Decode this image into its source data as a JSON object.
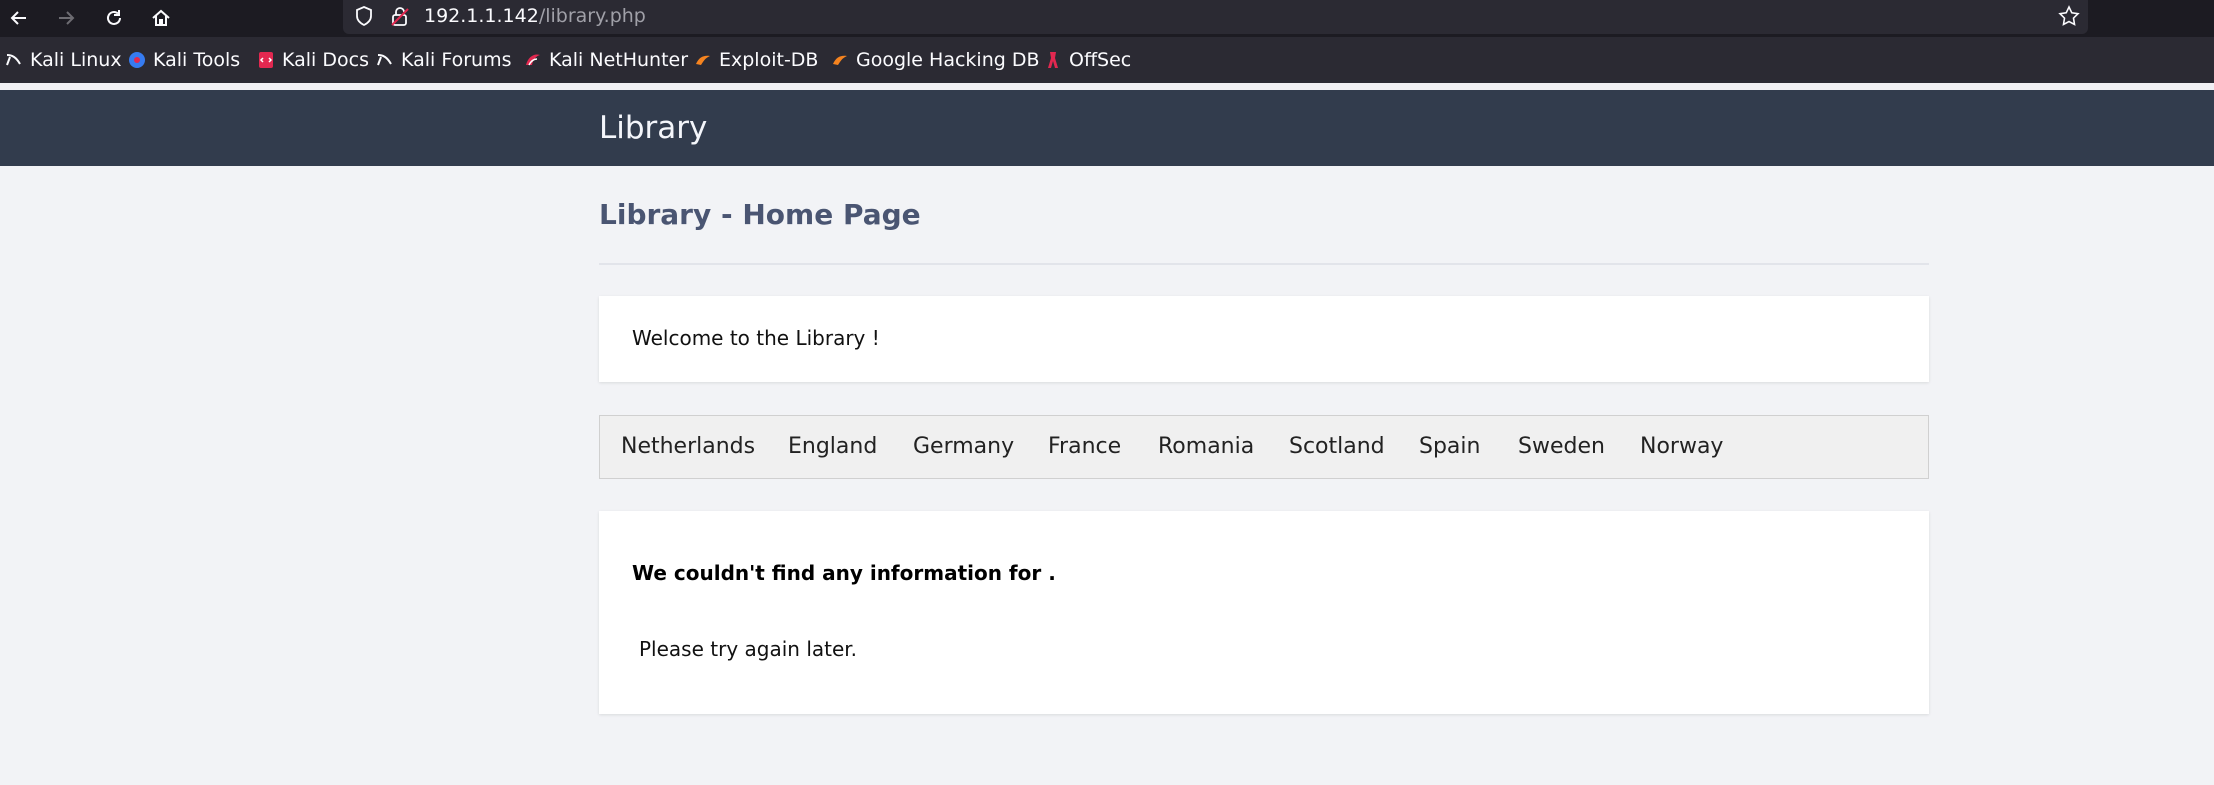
{
  "browser": {
    "url_host": "192.1.1.142",
    "url_path": "/library.php",
    "bookmarks": [
      {
        "label": "Kali Linux",
        "icon": "kali-dragon-icon"
      },
      {
        "label": "Kali Tools",
        "icon": "kali-tools-icon"
      },
      {
        "label": "Kali Docs",
        "icon": "kali-docs-icon"
      },
      {
        "label": "Kali Forums",
        "icon": "kali-dragon-icon"
      },
      {
        "label": "Kali NetHunter",
        "icon": "nethunter-icon"
      },
      {
        "label": "Exploit-DB",
        "icon": "exploit-db-icon"
      },
      {
        "label": "Google Hacking DB",
        "icon": "ghdb-icon"
      },
      {
        "label": "OffSec",
        "icon": "offsec-icon"
      }
    ]
  },
  "site": {
    "title": "Library",
    "heading": "Library - Home Page",
    "welcome": "Welcome to the Library !",
    "countries": [
      "Netherlands",
      "England",
      "Germany",
      "France",
      "Romania",
      "Scotland",
      "Spain",
      "Sweden",
      "Norway"
    ],
    "not_found": "We couldn't find any information for .",
    "try_later": "Please try again later."
  },
  "colors": {
    "header_bg": "#323c4d",
    "heading": "#4a5572",
    "page_bg": "#f2f3f6"
  }
}
